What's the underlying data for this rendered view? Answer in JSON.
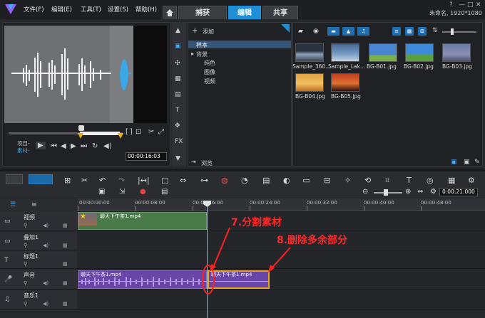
{
  "menu": [
    "文件(F)",
    "编辑(E)",
    "工具(T)",
    "设置(S)",
    "帮助(H)"
  ],
  "main_tabs": [
    "捕获",
    "编辑",
    "共享"
  ],
  "project_info": "未命名, 1920*1080",
  "preview": {
    "mode_project": "项目-",
    "mode_clip": "素材-",
    "timecode": "00:00:16:03"
  },
  "library": {
    "add_label": "添加",
    "browse_label": "浏览",
    "tree": [
      "样本",
      "背景",
      "纯色",
      "图像",
      "视频"
    ],
    "thumbs": [
      {
        "label": "Sample_360...",
        "color": "#8aa0b8"
      },
      {
        "label": "Sample_Lak...",
        "color": "#6e95c0"
      },
      {
        "label": "BG-B01.jpg",
        "color": "#4a86d0"
      },
      {
        "label": "BG-B02.jpg",
        "color": "#3c8ad8"
      },
      {
        "label": "BG-B03.jpg",
        "color": "#6a7aa8"
      },
      {
        "label": "BG-B04.jpg",
        "color": "#e0a040"
      },
      {
        "label": "BG-B05.jpg",
        "color": "#c04020"
      }
    ]
  },
  "timeline": {
    "timecode": "0:00:21:000",
    "ruler": [
      "00:00:00:00",
      "00:00:08:00",
      "00:00:16:00",
      "00:00:24:00",
      "00:00:32:00",
      "00:00:40:00",
      "00:00:48:00"
    ],
    "tracks": [
      "视频",
      "叠加1",
      "标题1",
      "声音",
      "音乐1"
    ],
    "video_clip": "聊天下午茶1.mp4",
    "audio_clip_a": "聊天下午茶1.mp4",
    "audio_clip_b": "聊天下午茶1.mp4"
  },
  "annotations": {
    "split": "7.分割素材",
    "delete": "8.删除多余部分"
  },
  "colors": {
    "accent": "#1f8fd8",
    "annotation": "#ff2a2a",
    "audio_clip": "#6a45a8",
    "video_clip": "#4a7a4a"
  }
}
